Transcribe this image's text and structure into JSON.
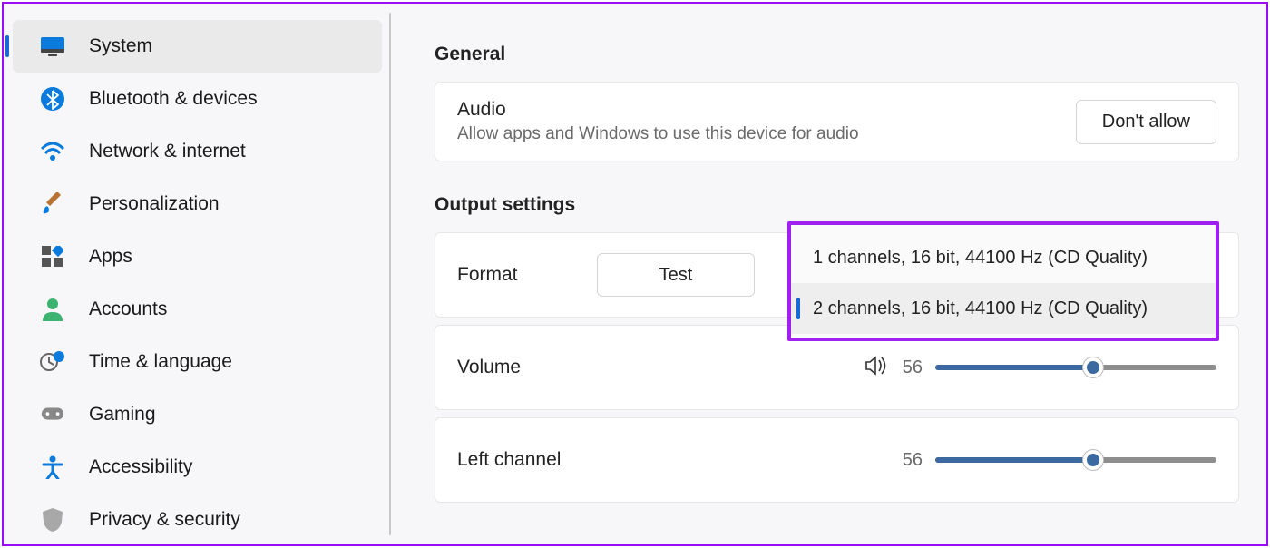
{
  "sidebar": {
    "items": [
      {
        "label": "System",
        "icon": "display-icon",
        "active": true
      },
      {
        "label": "Bluetooth & devices",
        "icon": "bluetooth-icon",
        "active": false
      },
      {
        "label": "Network & internet",
        "icon": "wifi-icon",
        "active": false
      },
      {
        "label": "Personalization",
        "icon": "brush-icon",
        "active": false
      },
      {
        "label": "Apps",
        "icon": "apps-icon",
        "active": false
      },
      {
        "label": "Accounts",
        "icon": "person-icon",
        "active": false
      },
      {
        "label": "Time & language",
        "icon": "clock-globe-icon",
        "active": false
      },
      {
        "label": "Gaming",
        "icon": "gamepad-icon",
        "active": false
      },
      {
        "label": "Accessibility",
        "icon": "accessibility-icon",
        "active": false
      },
      {
        "label": "Privacy & security",
        "icon": "shield-icon",
        "active": false
      }
    ]
  },
  "main": {
    "general": {
      "heading": "General",
      "audio_title": "Audio",
      "audio_desc": "Allow apps and Windows to use this device for audio",
      "dont_allow": "Don't allow"
    },
    "output": {
      "heading": "Output settings",
      "format_label": "Format",
      "test_btn": "Test",
      "format_options": [
        "1 channels, 16 bit, 44100 Hz (CD Quality)",
        "2 channels, 16 bit, 44100 Hz (CD Quality)"
      ],
      "volume_label": "Volume",
      "volume_value": "56",
      "left_label": "Left channel",
      "left_value": "56"
    }
  }
}
